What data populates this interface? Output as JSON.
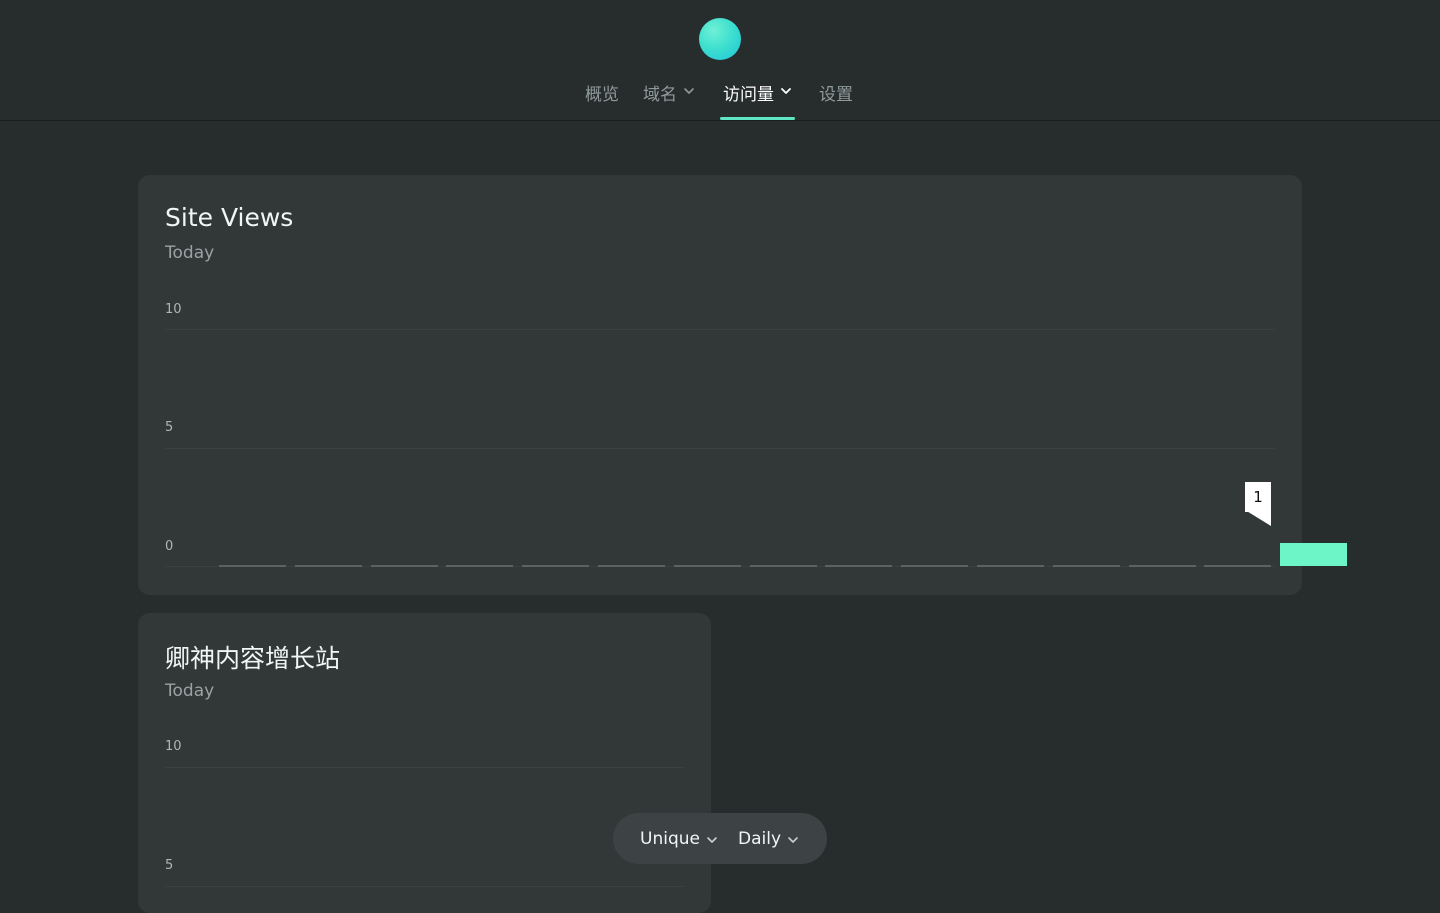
{
  "nav": {
    "items": [
      {
        "label": "概览",
        "has_dropdown": false,
        "active": false
      },
      {
        "label": "域名",
        "has_dropdown": true,
        "active": false
      },
      {
        "label": "访问量",
        "has_dropdown": true,
        "active": true
      },
      {
        "label": "设置",
        "has_dropdown": false,
        "active": false
      }
    ]
  },
  "colors": {
    "accent": "#6ef5c7",
    "background": "#272c2d",
    "card": "#323738"
  },
  "cards": [
    {
      "title": "Site Views",
      "subtitle": "Today",
      "y_ticks": [
        "10",
        "5",
        "0"
      ]
    },
    {
      "title": "卿神内容增长站",
      "subtitle": "Today",
      "y_ticks": [
        "10",
        "5"
      ]
    }
  ],
  "chart_data": [
    {
      "type": "bar",
      "title": "Site Views",
      "subtitle": "Today",
      "ylim": [
        0,
        10
      ],
      "y_ticks": [
        0,
        5,
        10
      ],
      "values": [
        0,
        0,
        0,
        0,
        0,
        0,
        0,
        0,
        0,
        0,
        0,
        0,
        0,
        0,
        1
      ],
      "tooltip": "1"
    },
    {
      "type": "bar",
      "title": "卿神内容增长站",
      "subtitle": "Today",
      "ylim": [
        0,
        10
      ],
      "y_ticks": [
        5,
        10
      ],
      "values": []
    }
  ],
  "controls": {
    "metric_label": "Unique",
    "interval_label": "Daily"
  }
}
